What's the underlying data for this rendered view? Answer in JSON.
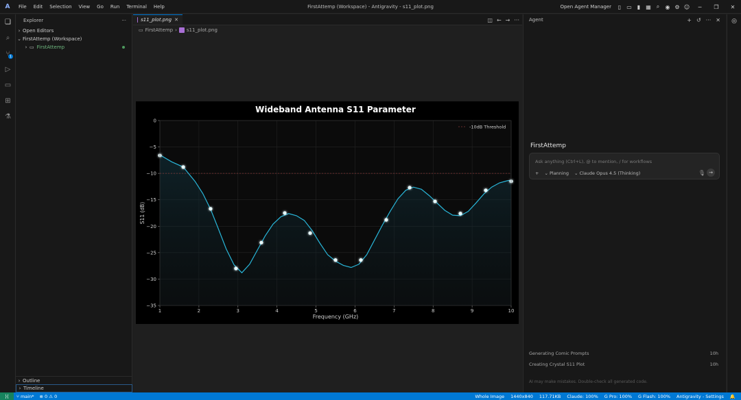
{
  "titlebar": {
    "menu": [
      "File",
      "Edit",
      "Selection",
      "View",
      "Go",
      "Run",
      "Terminal",
      "Help"
    ],
    "title": "FirstAttemp (Workspace) - Antigravity - s11_plot.png",
    "agent_manager": "Open Agent Manager"
  },
  "sidebar": {
    "header": "Explorer",
    "open_editors": "Open Editors",
    "workspace": "FirstAttemp (Workspace)",
    "folder": "FirstAttemp",
    "outline": "Outline",
    "timeline": "Timeline"
  },
  "editor": {
    "tab_label": "s11_plot.png",
    "breadcrumb": [
      "FirstAttemp",
      "s11_plot.png"
    ]
  },
  "chart_data": {
    "type": "line",
    "title": "Wideband Antenna S11 Parameter",
    "xlabel": "Frequency (GHz)",
    "ylabel": "S11 (dB)",
    "xlim": [
      1,
      10
    ],
    "ylim": [
      -35,
      0
    ],
    "xticks": [
      "1",
      "2",
      "3",
      "4",
      "5",
      "6",
      "7",
      "8",
      "9",
      "10"
    ],
    "yticks": [
      "0",
      "−5",
      "−10",
      "−15",
      "−20",
      "−25",
      "−30",
      "−35"
    ],
    "threshold": {
      "name": "-10dB Threshold",
      "value": -10
    },
    "grid": true,
    "legend": "top-right",
    "line_color": "#29b6d9",
    "series": [
      {
        "x": [
          1.0,
          1.3,
          1.6,
          1.9,
          2.1,
          2.3,
          2.5,
          2.7,
          2.9,
          3.1,
          3.3,
          3.5,
          3.7,
          3.9,
          4.1,
          4.3,
          4.5,
          4.7,
          4.9,
          5.1,
          5.3,
          5.5,
          5.7,
          5.9,
          6.1,
          6.3,
          6.5,
          6.7,
          6.9,
          7.1,
          7.3,
          7.5,
          7.7,
          7.9,
          8.1,
          8.3,
          8.5,
          8.7,
          8.9,
          9.1,
          9.3,
          9.5,
          9.7,
          9.9,
          10.0
        ],
        "y": [
          -6.5,
          -7.8,
          -8.8,
          -11.5,
          -13.8,
          -16.8,
          -20.5,
          -24.3,
          -27.3,
          -28.8,
          -27.2,
          -24.5,
          -21.8,
          -19.6,
          -18.2,
          -17.6,
          -18.0,
          -18.9,
          -20.8,
          -23.2,
          -25.4,
          -26.6,
          -27.4,
          -27.8,
          -27.2,
          -25.4,
          -22.6,
          -19.8,
          -17.2,
          -14.8,
          -13.2,
          -12.6,
          -13.0,
          -14.2,
          -15.6,
          -17.0,
          -17.9,
          -18.0,
          -17.2,
          -15.6,
          -13.9,
          -12.6,
          -11.8,
          -11.4,
          -11.3
        ]
      }
    ],
    "markers": {
      "x": [
        1.0,
        1.6,
        2.3,
        2.95,
        3.6,
        4.2,
        4.85,
        5.5,
        6.15,
        6.8,
        7.4,
        8.05,
        8.7,
        9.35,
        10.0
      ],
      "y": [
        -6.6,
        -8.8,
        -16.7,
        -28.0,
        -23.1,
        -17.5,
        -21.3,
        -26.4,
        -26.4,
        -18.8,
        -12.7,
        -15.3,
        -17.6,
        -13.2,
        -11.5
      ]
    }
  },
  "agent": {
    "header": "Agent",
    "conversation_title": "FirstAttemp",
    "placeholder": "Ask anything (Ctrl+L), @ to mention, / for workflows",
    "mode": "Planning",
    "model": "Claude Opus 4.5 (Thinking)",
    "history": [
      {
        "title": "Generating Comic Prompts",
        "age": "10h"
      },
      {
        "title": "Creating Crystal S11 Plot",
        "age": "10h"
      }
    ],
    "disclaimer": "AI may make mistakes. Double-check all generated code."
  },
  "statusbar": {
    "branch": "main*",
    "problems": "0",
    "warnings": "0",
    "right": [
      "Whole Image",
      "1440x840",
      "117.71KB",
      "Claude: 100%",
      "G Pro: 100%",
      "G Flash: 100%",
      "Antigravity - Settings"
    ]
  }
}
